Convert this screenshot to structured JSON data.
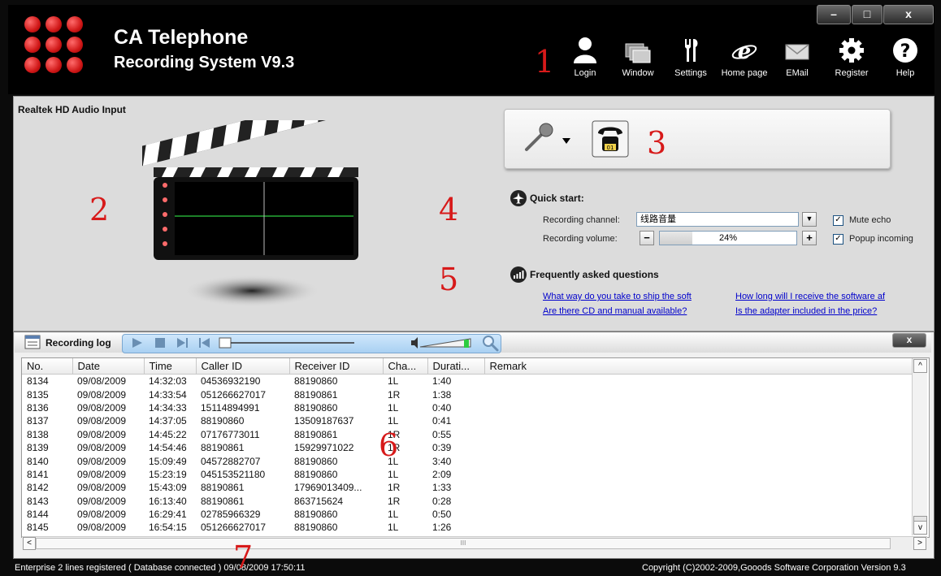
{
  "header": {
    "title": "CA Telephone",
    "subtitle": "Recording System V9.3",
    "toolbar": [
      {
        "label": "Login",
        "icon": "login-icon"
      },
      {
        "label": "Window",
        "icon": "window-icon"
      },
      {
        "label": "Settings",
        "icon": "settings-icon"
      },
      {
        "label": "Home page",
        "icon": "homepage-icon"
      },
      {
        "label": "EMail",
        "icon": "email-icon"
      },
      {
        "label": "Register",
        "icon": "register-icon"
      },
      {
        "label": "Help",
        "icon": "help-icon"
      }
    ],
    "window_controls": {
      "minimize": "–",
      "maximize": "□",
      "close": "x"
    }
  },
  "annotations": [
    "1",
    "2",
    "3",
    "4",
    "5",
    "6",
    "7"
  ],
  "main": {
    "audio_input_label": "Realtek HD Audio Input",
    "quick_start": {
      "title": "Quick start:",
      "channel_label": "Recording channel:",
      "channel_value": "线路音量",
      "volume_label": "Recording volume:",
      "volume_value": "24%",
      "volume_percent": 24,
      "volume_minus": "−",
      "volume_plus": "+",
      "dropdown": "▼",
      "mute_echo_label": "Mute echo",
      "mute_echo_checked": true,
      "popup_incoming_label": "Popup incoming",
      "popup_incoming_checked": true
    },
    "faq": {
      "title": "Frequently asked questions",
      "links": [
        "What way do you take to ship the soft",
        "How long will I receive the software af",
        "Are there CD and manual available?",
        "Is the adapter included in the price?"
      ]
    }
  },
  "log": {
    "title": "Recording log",
    "close": "x",
    "columns": [
      "No.",
      "Date",
      "Time",
      "Caller ID",
      "Receiver ID",
      "Cha...",
      "Durati...",
      "Remark"
    ],
    "rows": [
      [
        "8134",
        "09/08/2009",
        "14:32:03",
        "04536932190",
        "88190860",
        "1L",
        "1:40",
        ""
      ],
      [
        "8135",
        "09/08/2009",
        "14:33:54",
        "051266627017",
        "88190861",
        "1R",
        "1:38",
        ""
      ],
      [
        "8136",
        "09/08/2009",
        "14:34:33",
        "15114894991",
        "88190860",
        "1L",
        "0:40",
        ""
      ],
      [
        "8137",
        "09/08/2009",
        "14:37:05",
        "88190860",
        "13509187637",
        "1L",
        "0:41",
        ""
      ],
      [
        "8138",
        "09/08/2009",
        "14:45:22",
        "07176773011",
        "88190861",
        "1R",
        "0:55",
        ""
      ],
      [
        "8139",
        "09/08/2009",
        "14:54:46",
        "88190861",
        "15929971022",
        "1R",
        "0:39",
        ""
      ],
      [
        "8140",
        "09/08/2009",
        "15:09:49",
        "04572882707",
        "88190860",
        "1L",
        "3:40",
        ""
      ],
      [
        "8141",
        "09/08/2009",
        "15:23:19",
        "045153521180",
        "88190860",
        "1L",
        "2:09",
        ""
      ],
      [
        "8142",
        "09/08/2009",
        "15:43:09",
        "88190861",
        "17969013409...",
        "1R",
        "1:33",
        ""
      ],
      [
        "8143",
        "09/08/2009",
        "16:13:40",
        "88190861",
        "863715624",
        "1R",
        "0:28",
        ""
      ],
      [
        "8144",
        "09/08/2009",
        "16:29:41",
        "02785966329",
        "88190860",
        "1L",
        "0:50",
        ""
      ],
      [
        "8145",
        "09/08/2009",
        "16:54:15",
        "051266627017",
        "88190860",
        "1L",
        "1:26",
        ""
      ]
    ],
    "scroll_left": "<",
    "scroll_right": ">",
    "scroll_up": "^",
    "scroll_down": "v",
    "hscroll_grip": "III"
  },
  "status": {
    "left": "Enterprise 2 lines registered ( Database connected )    09/08/2009   17:50:11",
    "right": "Copyright (C)2002-2009,Gooods Software Corporation  Version 9.3"
  },
  "colors": {
    "accent_red": "#d71a1a",
    "header_bg": "#000000",
    "panel_bg": "#dcdcdc",
    "link": "#0000cc"
  }
}
